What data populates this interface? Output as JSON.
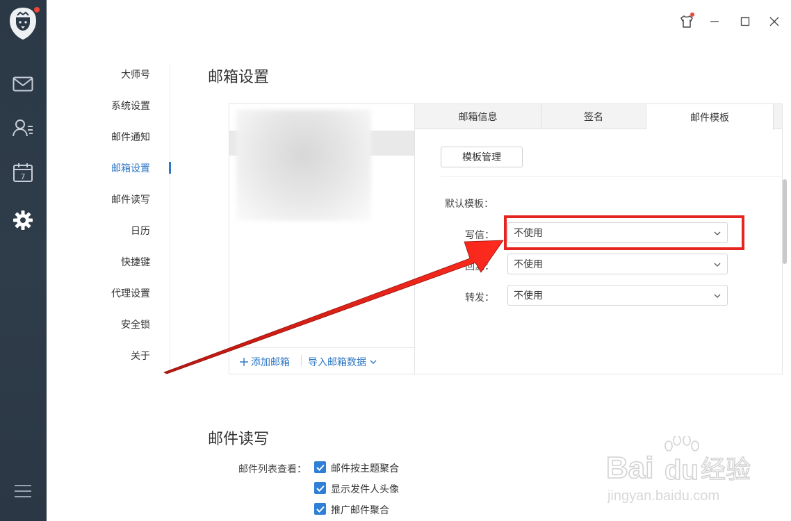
{
  "rail": {
    "icons": [
      "logo-icon",
      "mail-icon",
      "contacts-icon",
      "calendar-icon",
      "gear-icon",
      "menu-icon"
    ],
    "calendar_day": "7"
  },
  "window": {
    "controls": [
      "skin-icon",
      "minimize-icon",
      "maximize-icon",
      "close-icon"
    ]
  },
  "nav": {
    "items": [
      {
        "label": "大师号"
      },
      {
        "label": "系统设置"
      },
      {
        "label": "邮件通知"
      },
      {
        "label": "邮箱设置"
      },
      {
        "label": "邮件读写"
      },
      {
        "label": "日历"
      },
      {
        "label": "快捷键"
      },
      {
        "label": "代理设置"
      },
      {
        "label": "安全锁"
      },
      {
        "label": "关于"
      }
    ],
    "active": "邮箱设置"
  },
  "mailbox": {
    "title": "邮箱设置",
    "add_label": "添加邮箱",
    "import_label": "导入邮箱数据",
    "tabs": [
      {
        "label": "邮箱信息"
      },
      {
        "label": "签名"
      },
      {
        "label": "邮件模板"
      }
    ],
    "active_tab": "邮件模板",
    "manage_button": "模板管理",
    "default_label": "默认模板：",
    "rows": [
      {
        "label": "写信：",
        "value": "不使用"
      },
      {
        "label": "回复：",
        "value": "不使用"
      },
      {
        "label": "转发：",
        "value": "不使用"
      }
    ]
  },
  "reading": {
    "title": "邮件读写",
    "list_label": "邮件列表查看：",
    "options": [
      {
        "label": "邮件按主题聚合",
        "checked": true
      },
      {
        "label": "显示发件人头像",
        "checked": true
      },
      {
        "label": "推广邮件聚合",
        "checked": true
      }
    ]
  },
  "watermark": {
    "brand": "Bai",
    "brand2": "du",
    "cn": "经验",
    "url": "jingyan.baidu.com"
  },
  "colors": {
    "rail": "#2d3a48",
    "accent": "#2f78c6",
    "highlight": "#e42520",
    "checkbox": "#2f7fd6"
  }
}
